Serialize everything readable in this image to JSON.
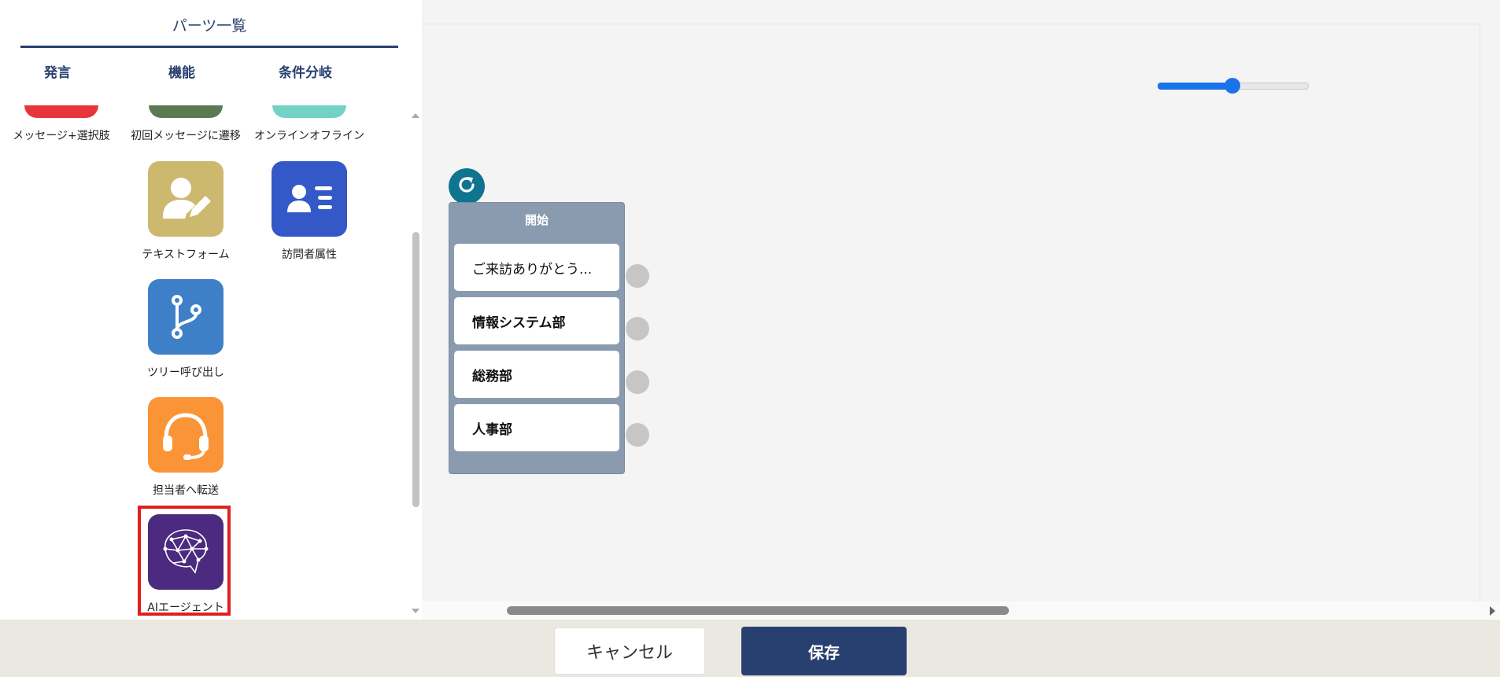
{
  "panel": {
    "title": "パーツ一覧",
    "tabs": [
      {
        "label": "発言"
      },
      {
        "label": "機能"
      },
      {
        "label": "条件分岐"
      }
    ],
    "partial_items": [
      {
        "label": "メッセージ+選択肢",
        "color": "#e8353b"
      },
      {
        "label": "初回メッセージに遷移",
        "color": "#5a7a52"
      },
      {
        "label": "オンラインオフライン",
        "color": "#72d2c6"
      }
    ],
    "items": [
      {
        "label": "テキストフォーム",
        "icon": "user-edit-icon",
        "color": "#cdb86f"
      },
      {
        "label": "訪問者属性",
        "icon": "id-card-icon",
        "color": "#3458c7"
      },
      {
        "label": "ツリー呼び出し",
        "icon": "branch-icon",
        "color": "#3d80c8"
      },
      {
        "label": "担当者へ転送",
        "icon": "headset-icon",
        "color": "#fb9436"
      },
      {
        "label": "AIエージェント",
        "icon": "ai-brain-icon",
        "color": "#4b2a7f"
      }
    ],
    "highlight_color": "#e0201f"
  },
  "canvas": {
    "zoom": 0.5,
    "start_node": {
      "title": "開始",
      "options": [
        {
          "label": "ご来訪ありがとう..."
        },
        {
          "label": "情報システム部"
        },
        {
          "label": "総務部"
        },
        {
          "label": "人事部"
        }
      ]
    }
  },
  "footer": {
    "cancel_label": "キャンセル",
    "save_label": "保存"
  },
  "colors": {
    "primary": "#27406f",
    "accent_blue": "#1a73e8",
    "node_bg": "#8a9bb0",
    "refresh": "#0e7490"
  }
}
